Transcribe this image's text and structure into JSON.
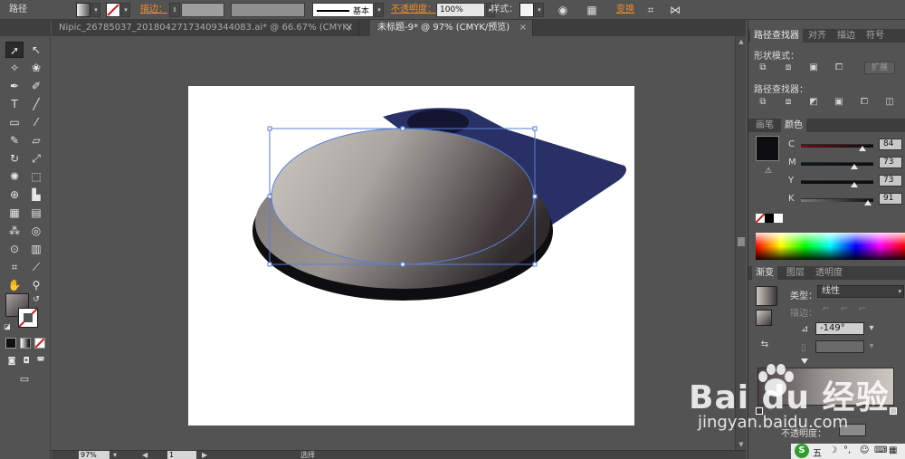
{
  "control_bar": {
    "object_type": "路径",
    "stroke_label": "描边：",
    "brush_label": "基本",
    "opacity_label": "不透明度：",
    "opacity_value": "100%",
    "style_label": "样式：",
    "transform_label": "变换"
  },
  "doc_tabs": [
    {
      "label": "Nipic_26785037_20180427173409344083.ai* @ 66.67% (CMYK/预览)"
    },
    {
      "label": "未标题-9* @ 97% (CMYK/预览)"
    }
  ],
  "status_bar": {
    "zoom": "97%",
    "page": "1",
    "tool": "选择"
  },
  "pathfinder_panel": {
    "tabs": [
      "路径查找器",
      "对齐",
      "描边",
      "符号"
    ],
    "shape_modes_label": "形状模式：",
    "expand_label": "扩展",
    "pathfinders_label": "路径查找器："
  },
  "color_panel": {
    "tabs": [
      "画笔",
      "颜色"
    ],
    "channels": [
      {
        "name": "C",
        "value": "84",
        "fraction": 0.84
      },
      {
        "name": "M",
        "value": "73",
        "fraction": 0.73
      },
      {
        "name": "Y",
        "value": "73",
        "fraction": 0.73
      },
      {
        "name": "K",
        "value": "91",
        "fraction": 0.91
      }
    ],
    "fill_color": "#0e0d10"
  },
  "gradient_panel": {
    "tabs": [
      "渐变",
      "图层",
      "透明度"
    ],
    "type_label": "类型：",
    "type_value": "线性",
    "stroke_label": "描边：",
    "angle_value": "-149°",
    "position_label": "位置",
    "opacity_label": "不透明度：",
    "gradient_start": "#4a4445",
    "gradient_end": "#cdc8c2"
  },
  "watermark": {
    "brand": "Bai du 经验",
    "url": "jingyan.baidu.com"
  },
  "tray": {
    "ime_label": "五"
  },
  "colors": {
    "ui_bg": "#535353",
    "accent_orange": "#f08c2a",
    "blue_shape": "#283066",
    "ellipse_light": "#cdc8c2",
    "ellipse_dark": "#3e3638"
  }
}
